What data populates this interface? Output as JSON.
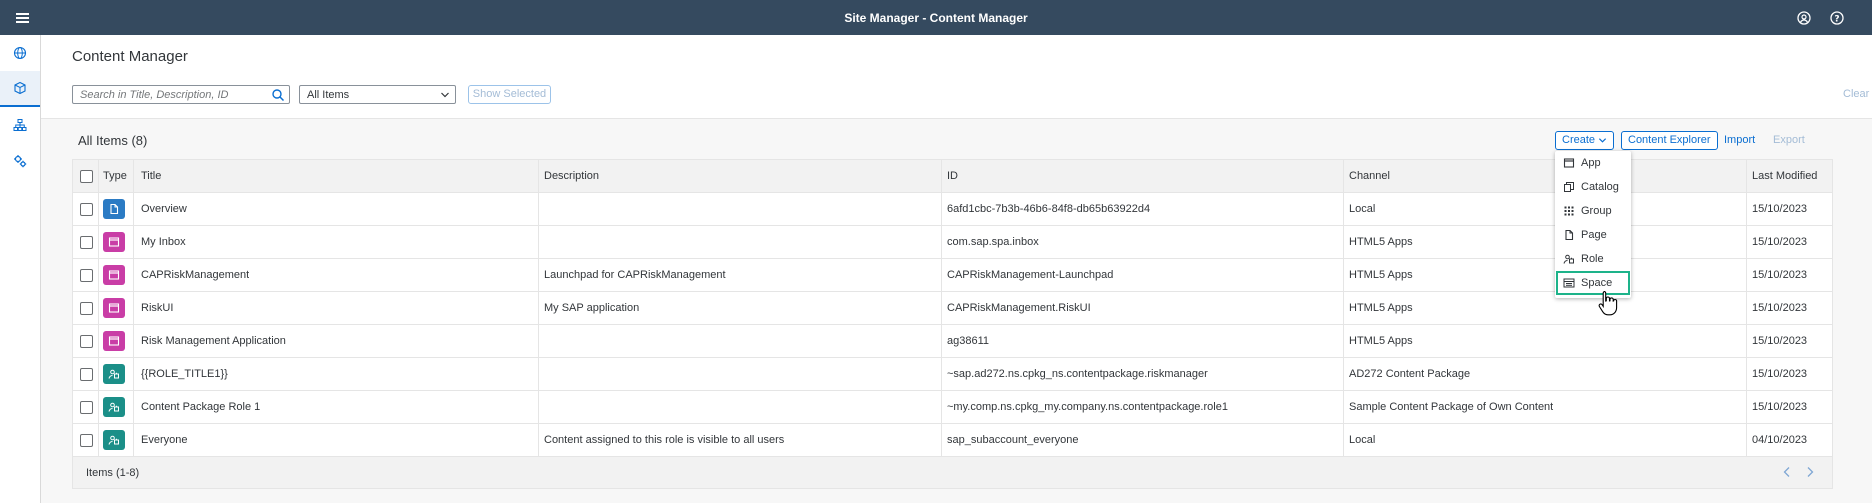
{
  "shell": {
    "title": "Site Manager - Content Manager"
  },
  "page": {
    "title": "Content Manager"
  },
  "filters": {
    "search_placeholder": "Search in Title, Description, ID",
    "select_value": "All Items",
    "show_selected_label": "Show Selected",
    "clear_label": "Clear"
  },
  "toolbar": {
    "count_label": "All Items (8)",
    "create_label": "Create",
    "content_explorer_label": "Content Explorer",
    "import_label": "Import",
    "export_label": "Export"
  },
  "table": {
    "columns": [
      "Type",
      "Title",
      "Description",
      "ID",
      "Channel",
      "Last Modified"
    ],
    "rows": [
      {
        "type_icon": "page-icon",
        "type_color": "#2b7bc4",
        "title": "Overview",
        "description": "",
        "id": "6afd1cbc-7b3b-46b6-84f8-db65b63922d4",
        "channel": "Local",
        "modified": "15/10/2023"
      },
      {
        "type_icon": "app-icon",
        "type_color": "#c93da6",
        "title": "My Inbox",
        "description": "",
        "id": "com.sap.spa.inbox",
        "channel": "HTML5 Apps",
        "modified": "15/10/2023"
      },
      {
        "type_icon": "app-icon",
        "type_color": "#c93da6",
        "title": "CAPRiskManagement",
        "description": "Launchpad for CAPRiskManagement",
        "id": "CAPRiskManagement-Launchpad",
        "channel": "HTML5 Apps",
        "modified": "15/10/2023"
      },
      {
        "type_icon": "app-icon",
        "type_color": "#c93da6",
        "title": "RiskUI",
        "description": "My SAP application",
        "id": "CAPRiskManagement.RiskUI",
        "channel": "HTML5 Apps",
        "modified": "15/10/2023"
      },
      {
        "type_icon": "app-icon",
        "type_color": "#c93da6",
        "title": "Risk Management Application",
        "description": "",
        "id": "ag38611",
        "channel": "HTML5 Apps",
        "modified": "15/10/2023"
      },
      {
        "type_icon": "role-icon",
        "type_color": "#1b8f88",
        "title": "{{ROLE_TITLE1}}",
        "description": "",
        "id": "~sap.ad272.ns.cpkg_ns.contentpackage.riskmanager",
        "channel": "AD272 Content Package",
        "modified": "15/10/2023"
      },
      {
        "type_icon": "role-icon",
        "type_color": "#1b8f88",
        "title": "Content Package Role 1",
        "description": "",
        "id": "~my.comp.ns.cpkg_my.company.ns.contentpackage.role1",
        "channel": "Sample Content Package of Own Content",
        "modified": "15/10/2023"
      },
      {
        "type_icon": "role-icon",
        "type_color": "#1b8f88",
        "title": "Everyone",
        "description": "Content assigned to this role is visible to all users",
        "id": "sap_subaccount_everyone",
        "channel": "Local",
        "modified": "04/10/2023"
      }
    ],
    "footer": "Items (1-8)"
  },
  "create_menu": {
    "items": [
      {
        "label": "App",
        "icon": "app-icon"
      },
      {
        "label": "Catalog",
        "icon": "catalog-icon"
      },
      {
        "label": "Group",
        "icon": "group-icon"
      },
      {
        "label": "Page",
        "icon": "page-icon"
      },
      {
        "label": "Role",
        "icon": "role-icon"
      },
      {
        "label": "Space",
        "icon": "space-icon"
      }
    ]
  },
  "colors": {
    "shell": "#354a5f",
    "accent": "#0a6ed1",
    "highlight": "#1db38a"
  }
}
